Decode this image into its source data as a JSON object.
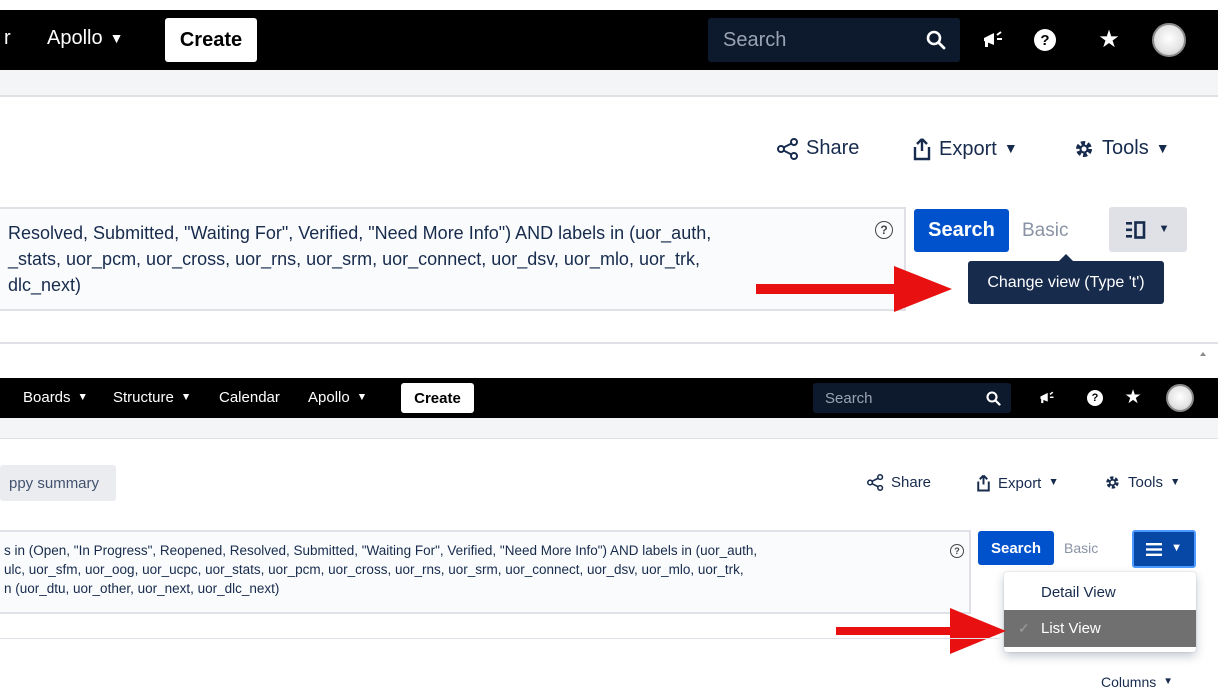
{
  "top": {
    "nav": {
      "partial_item": "r",
      "apollo": "Apollo",
      "create": "Create",
      "search_placeholder": "Search"
    },
    "actions": {
      "share": "Share",
      "export": "Export",
      "tools": "Tools"
    },
    "jql_lines": [
      "Resolved, Submitted, \"Waiting For\", Verified, \"Need More Info\") AND labels in (uor_auth,",
      "_stats, uor_pcm, uor_cross, uor_rns, uor_srm, uor_connect, uor_dsv, uor_mlo, uor_trk,",
      "dlc_next)"
    ],
    "search_button": "Search",
    "basic_link": "Basic",
    "tooltip": "Change view (Type 't')"
  },
  "bottom": {
    "nav": {
      "boards": "Boards",
      "structure": "Structure",
      "calendar": "Calendar",
      "apollo": "Apollo",
      "create": "Create",
      "search_placeholder": "Search"
    },
    "copy_summary": "ppy summary",
    "actions": {
      "share": "Share",
      "export": "Export",
      "tools": "Tools"
    },
    "jql_lines": [
      "s in (Open, \"In Progress\", Reopened, Resolved, Submitted, \"Waiting For\", Verified, \"Need More Info\") AND labels in (uor_auth,",
      "ulc, uor_sfm, uor_oog, uor_ucpc, uor_stats, uor_pcm, uor_cross, uor_rns, uor_srm, uor_connect, uor_dsv, uor_mlo, uor_trk,",
      "n (uor_dtu, uor_other, uor_next, uor_dlc_next)"
    ],
    "search_button": "Search",
    "basic_link": "Basic",
    "view_menu": {
      "options": [
        "Detail View",
        "List View"
      ],
      "selected": "List View"
    },
    "columns": "Columns"
  },
  "colors": {
    "nav_bg": "#000000",
    "primary": "#0052cc",
    "tooltip_bg": "#172b4d",
    "annotation_arrow": "#e81010",
    "selected_option_bg": "#707070"
  }
}
